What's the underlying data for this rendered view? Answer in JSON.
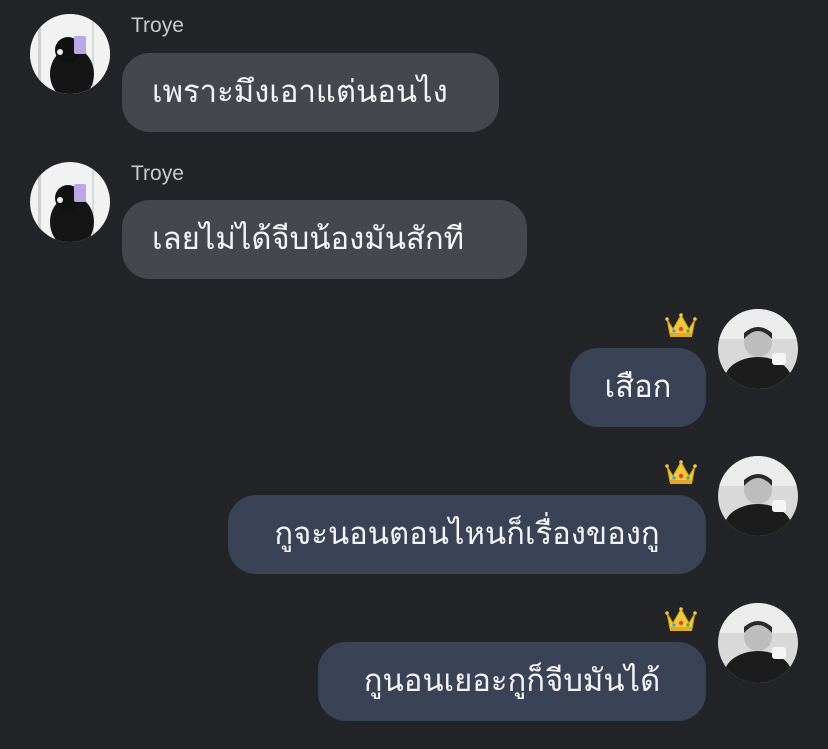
{
  "messages": [
    {
      "direction": "incoming",
      "sender": "Troye",
      "text": "เพราะมึงเอาแต่นอนไง"
    },
    {
      "direction": "incoming",
      "sender": "Troye",
      "text": "เลยไม่ได้จีบน้องมันสักที"
    },
    {
      "direction": "outgoing",
      "badge_icon": "crown-icon",
      "text": "เสือก"
    },
    {
      "direction": "outgoing",
      "badge_icon": "crown-icon",
      "text": "กูจะนอนตอนไหนก็เรื่องของกู"
    },
    {
      "direction": "outgoing",
      "badge_icon": "crown-icon",
      "text": "กูนอนเยอะกูก็จีบมันได้"
    }
  ],
  "colors": {
    "background": "#232428",
    "incoming_bubble": "#46474c",
    "outgoing_bubble": "#3a4356",
    "text": "#f4f4f6",
    "sender_name": "#c9cacd",
    "crown_gold": "#f3c93a"
  }
}
